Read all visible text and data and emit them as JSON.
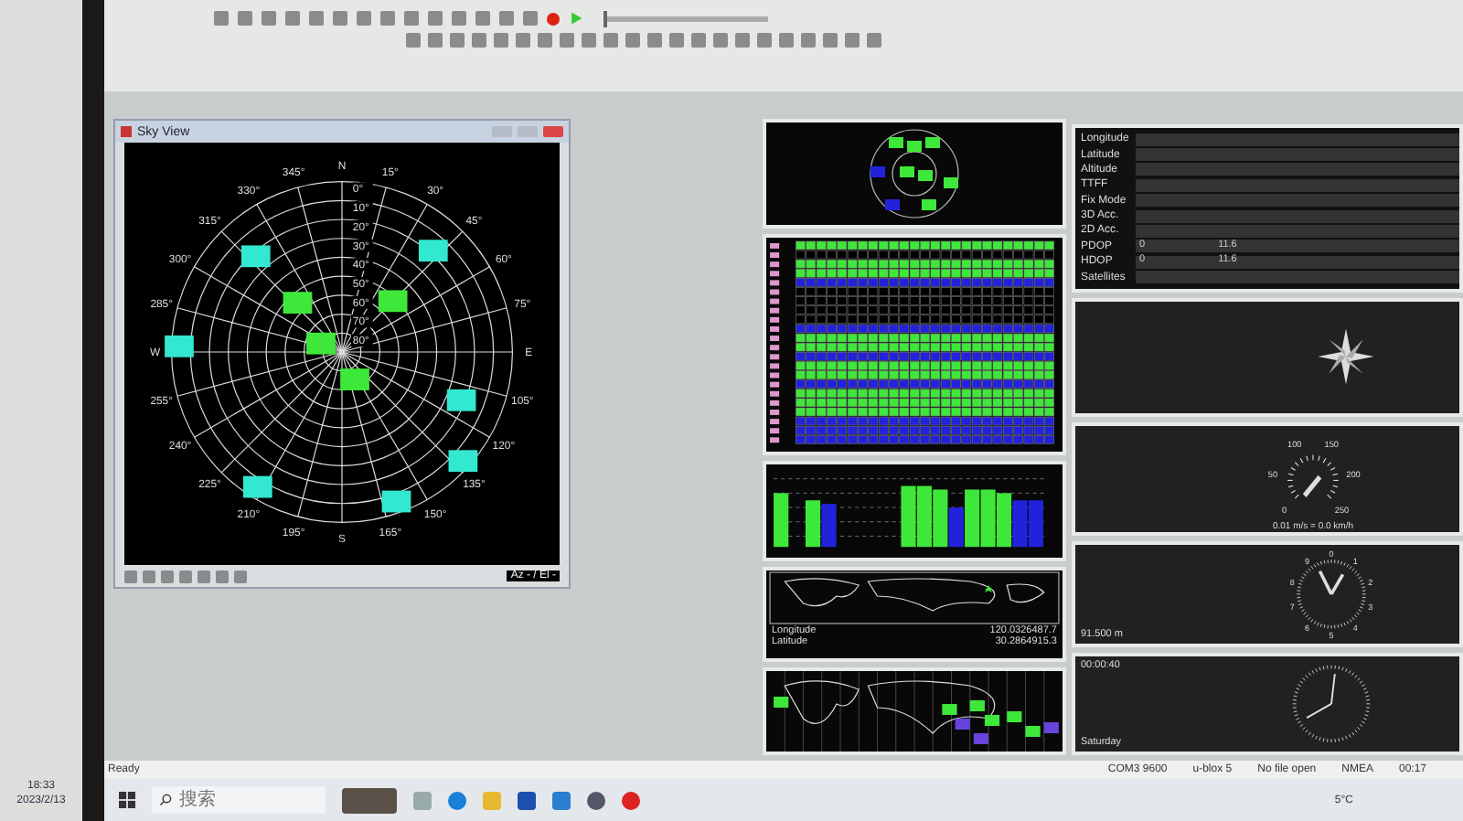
{
  "side_clock": {
    "time": "18:33",
    "date": "2023/2/13"
  },
  "sky_view": {
    "title": "Sky View",
    "east_azimuth_labels": [
      "N",
      "15°",
      "30°",
      "45°",
      "60°",
      "75°",
      "E",
      "105°",
      "120°",
      "135°",
      "150°",
      "165°",
      "S"
    ],
    "west_azimuth_labels": [
      "345°",
      "330°",
      "315°",
      "300°",
      "285°",
      "W",
      "255°",
      "240°",
      "225°",
      "210°",
      "195°"
    ],
    "elevation_labels": [
      "0°",
      "10°",
      "20°",
      "30°",
      "40°",
      "50°",
      "60°",
      "70°",
      "80°"
    ],
    "footer": "Az - / El -"
  },
  "data_panel": {
    "rows": [
      {
        "label": "Longitude",
        "values": []
      },
      {
        "label": "Latitude",
        "values": []
      },
      {
        "label": "Altitude",
        "values": []
      },
      {
        "label": "TTFF",
        "values": []
      },
      {
        "label": "Fix Mode",
        "values": []
      },
      {
        "label": "3D Acc.",
        "values": []
      },
      {
        "label": "2D Acc.",
        "values": []
      },
      {
        "label": "PDOP",
        "values": [
          "0",
          "11.6"
        ]
      },
      {
        "label": "HDOP",
        "values": [
          "0",
          "11.6"
        ]
      },
      {
        "label": "Satellites",
        "values": []
      }
    ]
  },
  "playback": {
    "level": 0
  },
  "speed_gauge": {
    "ticks": [
      "0",
      "50",
      "100",
      "150",
      "200",
      "250"
    ],
    "reading": "0.01 m/s = 0.0 km/h"
  },
  "altitude_dial": {
    "digits": [
      "0",
      "1",
      "2",
      "3",
      "4",
      "5",
      "6",
      "7",
      "8",
      "9"
    ],
    "reading": "91.500 m"
  },
  "time_panel": {
    "time": "00:00:40",
    "day": "Saturday"
  },
  "map_panel": {
    "labels": [
      "Longitude",
      "Latitude"
    ],
    "values": [
      "120.0326487.7",
      "30.2864915.3"
    ]
  },
  "status_bar": {
    "message": "Ready",
    "fields": [
      "COM3 9600",
      "u-blox 5",
      "No file open",
      "NMEA",
      "00:17"
    ]
  },
  "taskbar": {
    "search_placeholder": "搜索",
    "weather": "5°C"
  }
}
